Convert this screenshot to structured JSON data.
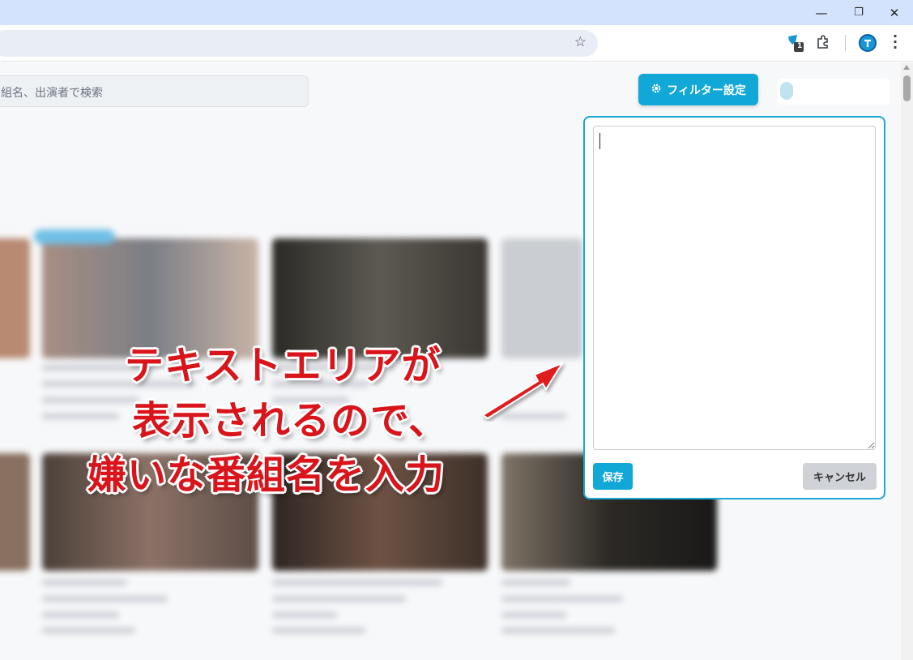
{
  "browser": {
    "window_controls": {
      "minimize": "—",
      "restore": "❐",
      "close": "✕"
    },
    "bookmark_icon": "star-icon",
    "extension_badge": "1",
    "toolbar_icons": [
      "extension-badge-icon",
      "puzzle-icon",
      "profile-icon",
      "kebab-menu-icon"
    ]
  },
  "page": {
    "search": {
      "placeholder": "組名、出演者で検索"
    },
    "filter_button": {
      "icon": "gear-icon",
      "label": "フィルター設定"
    }
  },
  "filter_popover": {
    "textarea_value": "",
    "save_label": "保存",
    "cancel_label": "キャンセル"
  },
  "annotation": {
    "lines": [
      "テキストエリアが",
      "表示されるので、",
      "嫌いな番組名を入力"
    ],
    "color": "#d9141b",
    "arrow_color": "#e01a1a"
  },
  "colors": {
    "accent": "#11a7d6",
    "titlebar": "#d3e3fd",
    "page_bg": "#f7f8fa"
  }
}
